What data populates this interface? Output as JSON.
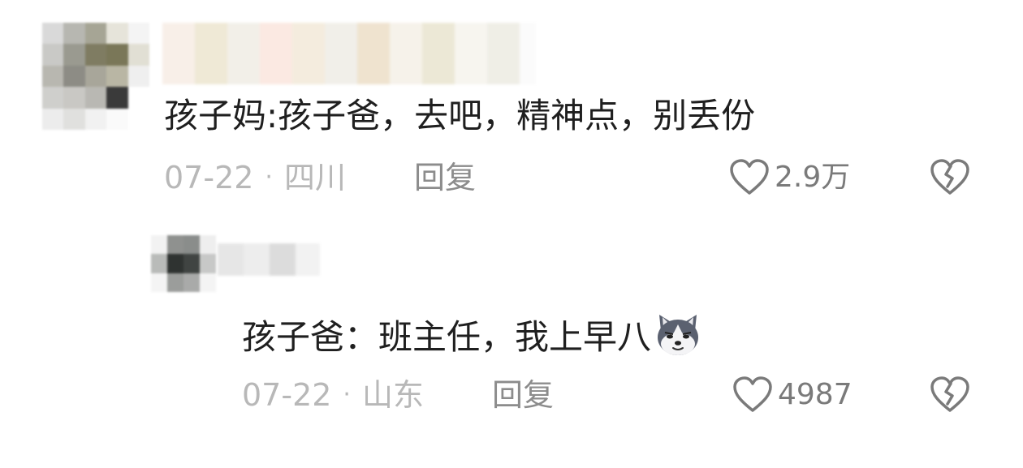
{
  "comments": [
    {
      "text": "孩子妈:孩子爸，去吧，精神点，别丢份",
      "date": "07-22",
      "location": "四川",
      "reply_label": "回复",
      "likes": "2.9万"
    },
    {
      "text": "孩子爸：班主任，我上早八",
      "date": "07-22",
      "location": "山东",
      "reply_label": "回复",
      "likes": "4987",
      "emoji": "husky-dog-emoji"
    }
  ],
  "icons": {
    "like": "heart-outline-icon",
    "dislike": "broken-heart-icon"
  },
  "colors": {
    "text": "#1f1f1f",
    "meta": "#b8b8b8",
    "reply": "#8c8c8c",
    "icon": "#7a7a7a"
  },
  "separator": "·"
}
